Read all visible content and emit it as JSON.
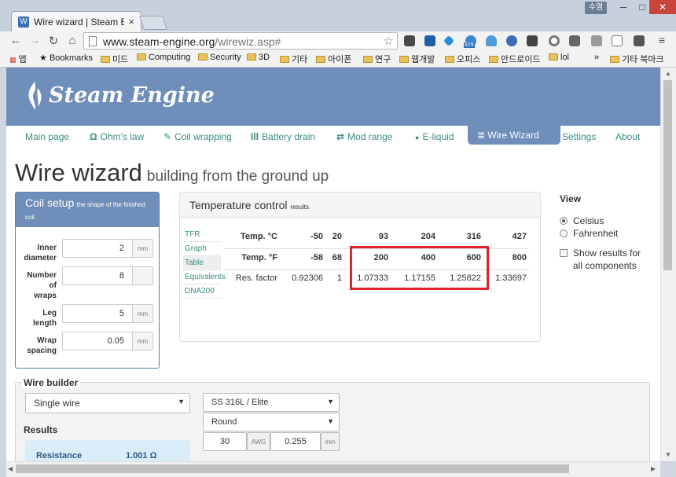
{
  "browser": {
    "tab_title": "Wire wizard | Steam Engine",
    "tab_close": "×",
    "user_badge": "수염",
    "url_host": "www.steam-engine.org",
    "url_path": "/wirewiz.asp#",
    "bookmarks": [
      "앱",
      "Bookmarks",
      "미드",
      "Computing",
      "Security",
      "3D",
      "기타",
      "아이폰",
      "연구",
      "웹개발",
      "오피스",
      "안드로이드",
      "lol",
      "»",
      "기타 북마크"
    ],
    "extension_badge": "829"
  },
  "site": {
    "logo_text": "Steam Engine",
    "nav": {
      "main": "Main page",
      "ohms": "Ohm's law",
      "coil": "Coil wrapping",
      "battery": "Battery drain",
      "mod": "Mod range",
      "eliquid": "E-liquid",
      "wizard": "Wire Wizard",
      "settings": "Settings",
      "about": "About"
    },
    "icons": {
      "ohms": "Ω",
      "coil": "✎",
      "battery": "Ill",
      "mod": "⇄",
      "eliquid": "●",
      "wizard": "≣"
    },
    "accent_color": "#6f8eb9",
    "link_color": "#3c8d83"
  },
  "page": {
    "title": "Wire wizard",
    "subtitle": "building from the ground up"
  },
  "coil_setup": {
    "title": "Coil setup",
    "note": "the shape of the finished coil",
    "fields": [
      {
        "label_1": "Inner",
        "label_2": "diameter",
        "value": "2",
        "unit": "mm"
      },
      {
        "label_1": "Number",
        "label_2": "of",
        "label_3": "wraps",
        "value": "8",
        "unit": ""
      },
      {
        "label_1": "Leg",
        "label_2": "length",
        "value": "5",
        "unit": "mm"
      },
      {
        "label_1": "Wrap",
        "label_2": "spacing",
        "value": "0.05",
        "unit": "mm"
      }
    ]
  },
  "temperature_control": {
    "title": "Temperature control",
    "title_small": "results",
    "tabs": [
      "TFR",
      "Graph",
      "Table",
      "Equivalents",
      "DNA200"
    ],
    "active_tab": "Table",
    "rows": [
      {
        "label": "Temp. °C",
        "values": [
          "-50",
          "20",
          "93",
          "204",
          "316",
          "427"
        ]
      },
      {
        "label": "Temp. °F",
        "values": [
          "-58",
          "68",
          "200",
          "400",
          "600",
          "800"
        ]
      },
      {
        "label": "Res. factor",
        "values": [
          "0.92306",
          "1",
          "1.07333",
          "1.17155",
          "1.25822",
          "1.33697"
        ]
      }
    ],
    "highlight_color": "#e2252a"
  },
  "view": {
    "title": "View",
    "celsius": "Celsius",
    "fahrenheit": "Fahrenheit",
    "show_results_1": "Show results for",
    "show_results_2": "all components",
    "selected": "Celsius"
  },
  "wire_builder": {
    "title": "Wire builder",
    "wire_type": "Single wire",
    "material": "SS 316L / Elite",
    "profile": "Round",
    "gauge": "30",
    "gauge_unit": "AWG",
    "diameter": "0.255",
    "diameter_unit": "mm",
    "results_title": "Results",
    "resistance_label": "Resistance",
    "resistance_value": "1.001 Ω"
  }
}
